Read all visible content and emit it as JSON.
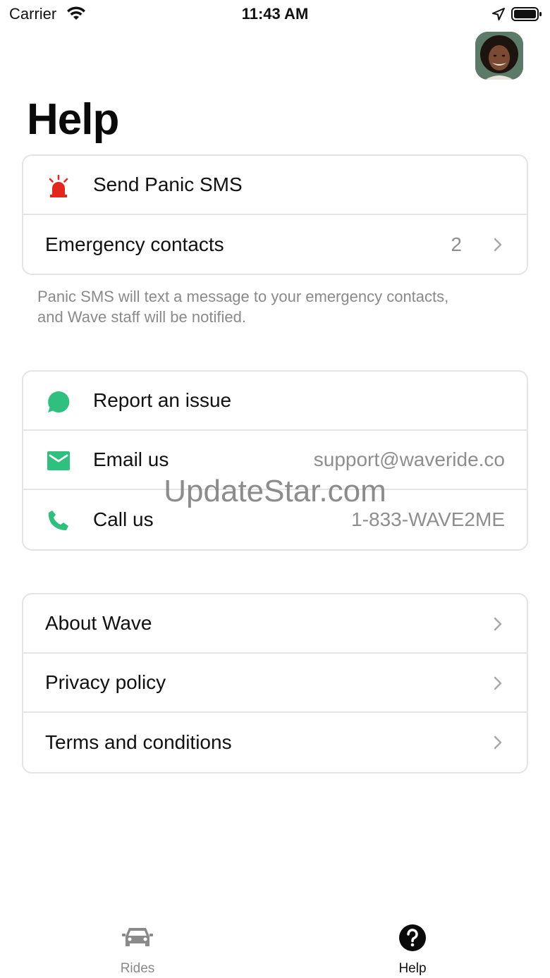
{
  "status_bar": {
    "carrier": "Carrier",
    "time": "11:43 AM",
    "icons": [
      "wifi-icon",
      "location-icon",
      "battery-icon"
    ]
  },
  "header": {
    "title": "Help",
    "avatar": "avatar"
  },
  "emergency": {
    "panic_label": "Send Panic SMS",
    "panic_icon": "siren-icon",
    "contacts_label": "Emergency contacts",
    "contacts_count": "2",
    "footnote": "Panic SMS will text a message to your emergency contacts, and Wave staff will be notified."
  },
  "support": {
    "report_label": "Report an issue",
    "report_icon": "chat-bubble-icon",
    "email_label": "Email us",
    "email_value": "support@waveride.co",
    "email_icon": "mail-icon",
    "call_label": "Call us",
    "call_value": "1-833-WAVE2ME",
    "call_icon": "phone-icon"
  },
  "info": {
    "about_label": "About Wave",
    "privacy_label": "Privacy policy",
    "terms_label": "Terms and conditions"
  },
  "watermark": "UpdateStar.com",
  "tabs": [
    {
      "label": "Rides",
      "icon": "car-icon",
      "active": false
    },
    {
      "label": "Help",
      "icon": "question-circle-icon",
      "active": true
    }
  ],
  "colors": {
    "panic_red": "#e5261f",
    "support_green": "#2fc07f",
    "secondary_text": "#8e8e8e",
    "divider": "#e4e4e4"
  }
}
